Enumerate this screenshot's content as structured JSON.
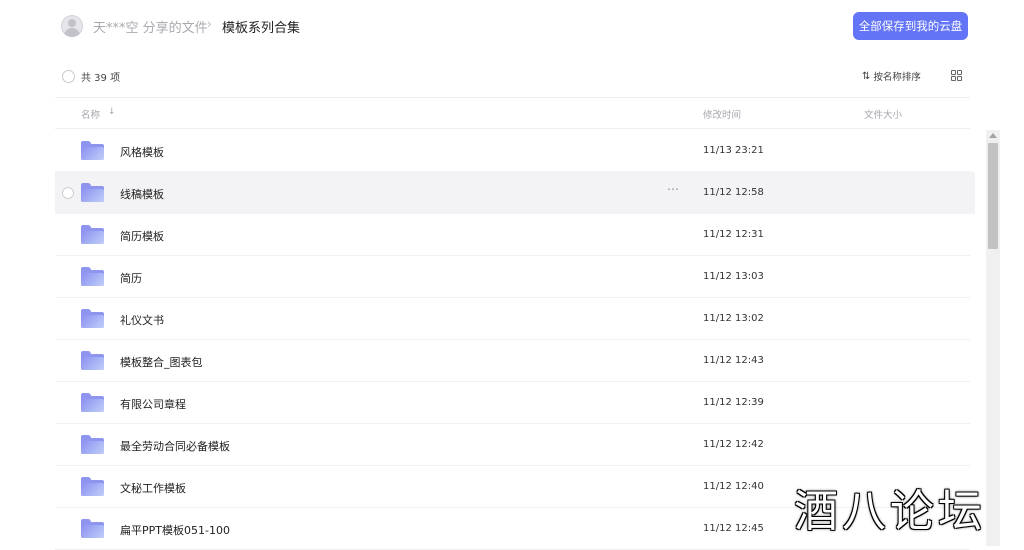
{
  "header": {
    "owner_label": "天***空 分享的文件",
    "separator": "›",
    "current_folder": "模板系列合集",
    "save_button_label": "全部保存到我的云盘"
  },
  "toolbar": {
    "total_count_label": "共 39 项",
    "sort_icon": "⇅",
    "sort_label": "按名称排序",
    "view_toggle_icon": "grid-view-icon"
  },
  "columns": {
    "name": "名称",
    "name_sort_arrow": "↓",
    "modified_time": "修改时间",
    "file_size": "文件大小"
  },
  "files": [
    {
      "name": "风格模板",
      "modified": "11/13 23:21",
      "size": "",
      "hovered": false
    },
    {
      "name": "线稿模板",
      "modified": "11/12 12:58",
      "size": "",
      "hovered": true
    },
    {
      "name": "简历模板",
      "modified": "11/12 12:31",
      "size": "",
      "hovered": false
    },
    {
      "name": "简历",
      "modified": "11/12 13:03",
      "size": "",
      "hovered": false
    },
    {
      "name": "礼仪文书",
      "modified": "11/12 13:02",
      "size": "",
      "hovered": false
    },
    {
      "name": "模板整合_图表包",
      "modified": "11/12 12:43",
      "size": "",
      "hovered": false
    },
    {
      "name": "有限公司章程",
      "modified": "11/12 12:39",
      "size": "",
      "hovered": false
    },
    {
      "name": "最全劳动合同必备模板",
      "modified": "11/12 12:42",
      "size": "",
      "hovered": false
    },
    {
      "name": "文秘工作模板",
      "modified": "11/12 12:40",
      "size": "",
      "hovered": false
    },
    {
      "name": "扁平PPT模板051-100",
      "modified": "11/12 12:45",
      "size": "",
      "hovered": false
    }
  ],
  "row_more_icon": "⋯",
  "watermark": "酒八论坛",
  "colors": {
    "accent": "#6374f7",
    "folder": "#8e95ef",
    "hover_row": "#f3f3f5"
  }
}
